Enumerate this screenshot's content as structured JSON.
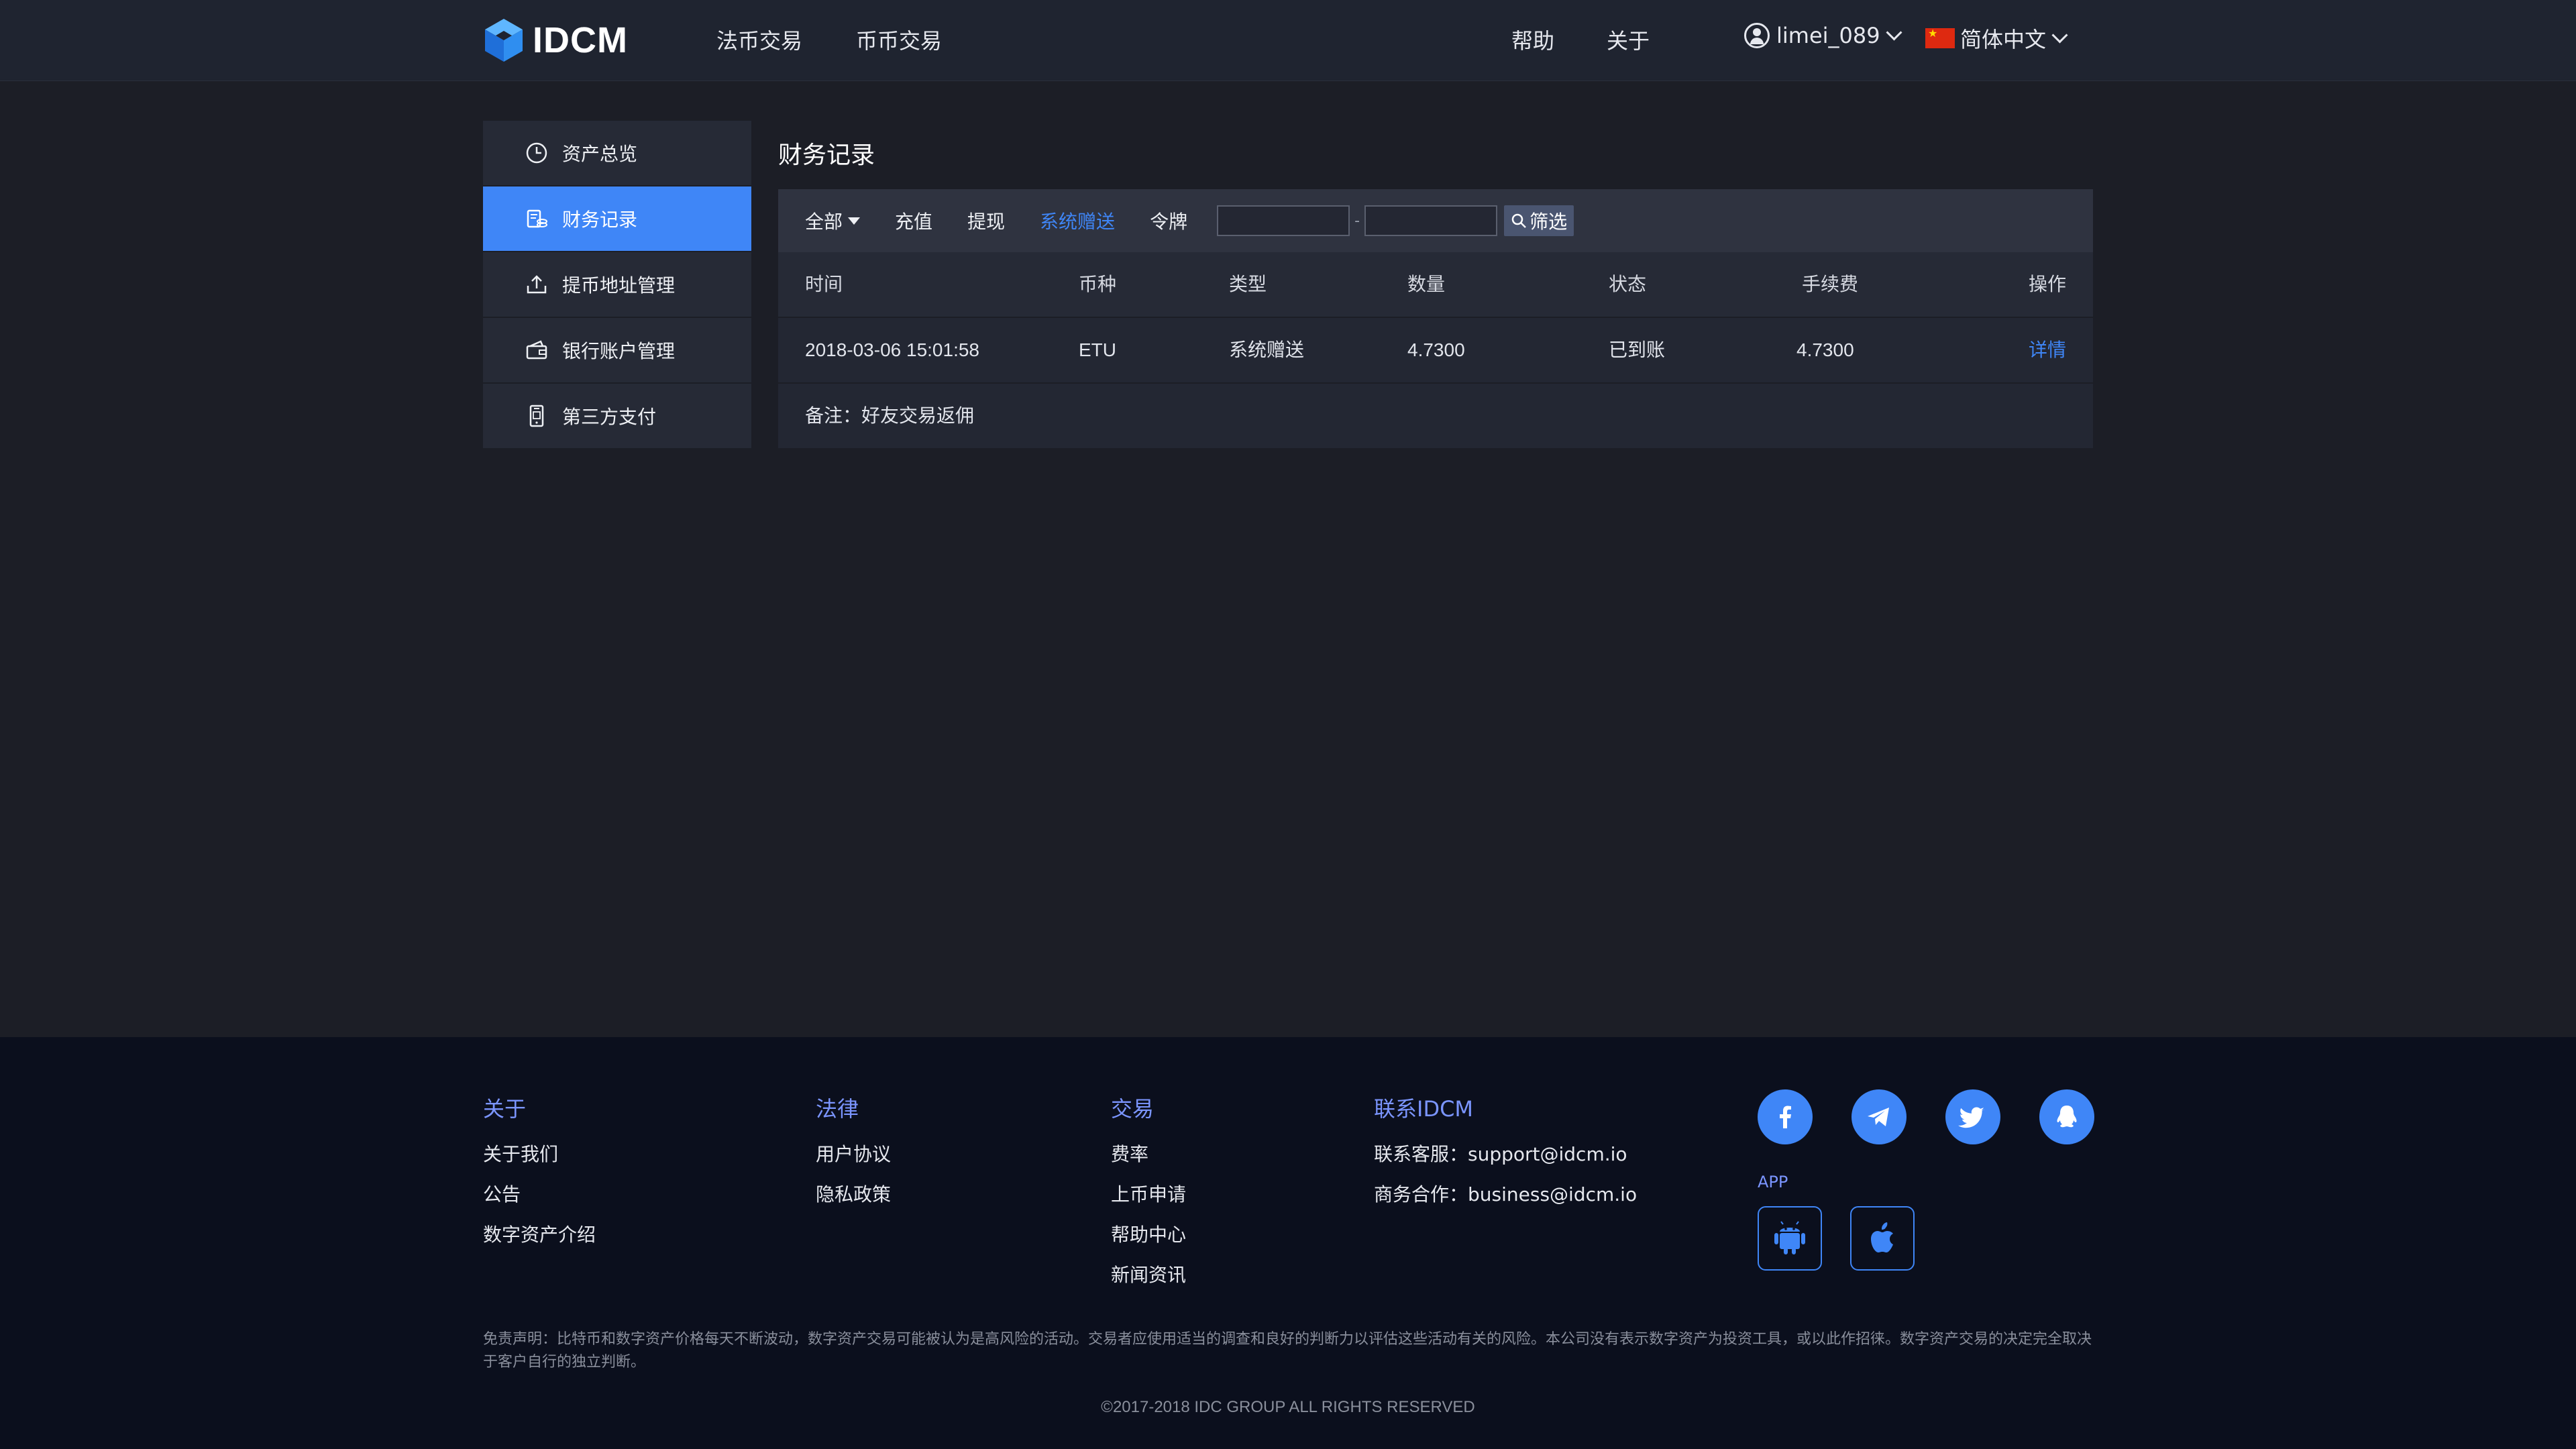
{
  "header": {
    "logo_text": "IDCM",
    "nav": [
      "法币交易",
      "币币交易",
      "帮助",
      "关于"
    ],
    "user": "limei_089",
    "language": "简体中文"
  },
  "sidebar": {
    "items": [
      {
        "label": "资产总览",
        "icon": "clock-icon",
        "active": false
      },
      {
        "label": "财务记录",
        "icon": "records-icon",
        "active": true
      },
      {
        "label": "提币地址管理",
        "icon": "upload-icon",
        "active": false
      },
      {
        "label": "银行账户管理",
        "icon": "wallet-icon",
        "active": false
      },
      {
        "label": "第三方支付",
        "icon": "phone-pay-icon",
        "active": false
      }
    ]
  },
  "main": {
    "title": "财务记录",
    "filters": [
      "全部",
      "充值",
      "提现",
      "系统赠送",
      "令牌"
    ],
    "active_filter": "系统赠送",
    "date_from": "",
    "date_to": "",
    "date_separator": "-",
    "filter_button": "筛选",
    "table": {
      "columns": [
        "时间",
        "币种",
        "类型",
        "数量",
        "状态",
        "手续费",
        "操作"
      ],
      "rows": [
        {
          "time": "2018-03-06 15:01:58",
          "coin": "ETU",
          "type": "系统赠送",
          "amount": "4.7300",
          "status": "已到账",
          "fee": "4.7300",
          "action": "详情"
        }
      ],
      "note": "备注：好友交易返佣"
    }
  },
  "footer": {
    "about": {
      "title": "关于",
      "links": [
        "关于我们",
        "公告",
        "数字资产介绍"
      ]
    },
    "legal": {
      "title": "法律",
      "links": [
        "用户协议",
        "隐私政策"
      ]
    },
    "trade": {
      "title": "交易",
      "links": [
        "费率",
        "上币申请",
        "帮助中心",
        "新闻资讯"
      ]
    },
    "contact": {
      "title": "联系IDCM",
      "lines": [
        "联系客服：support@idcm.io",
        "商务合作：business@idcm.io"
      ]
    },
    "social_icons": [
      "facebook-icon",
      "telegram-icon",
      "twitter-icon",
      "qq-icon"
    ],
    "app_label": "APP",
    "app_icons": [
      "android-icon",
      "apple-icon"
    ],
    "disclaimer": "免责声明：比特币和数字资产价格每天不断波动，数字资产交易可能被认为是高风险的活动。交易者应使用适当的调查和良好的判断力以评估这些活动有关的风险。本公司没有表示数字资产为投资工具，或以此作招徕。数字资产交易的决定完全取决于客户自行的独立判断。",
    "copyright": "©2017-2018 IDC GROUP ALL RIGHTS RESERVED"
  },
  "colors": {
    "accent": "#3f86f7",
    "background": "#1c1e26",
    "footer_bg": "#0b0f1d",
    "footer_heading": "#7b95ff"
  }
}
